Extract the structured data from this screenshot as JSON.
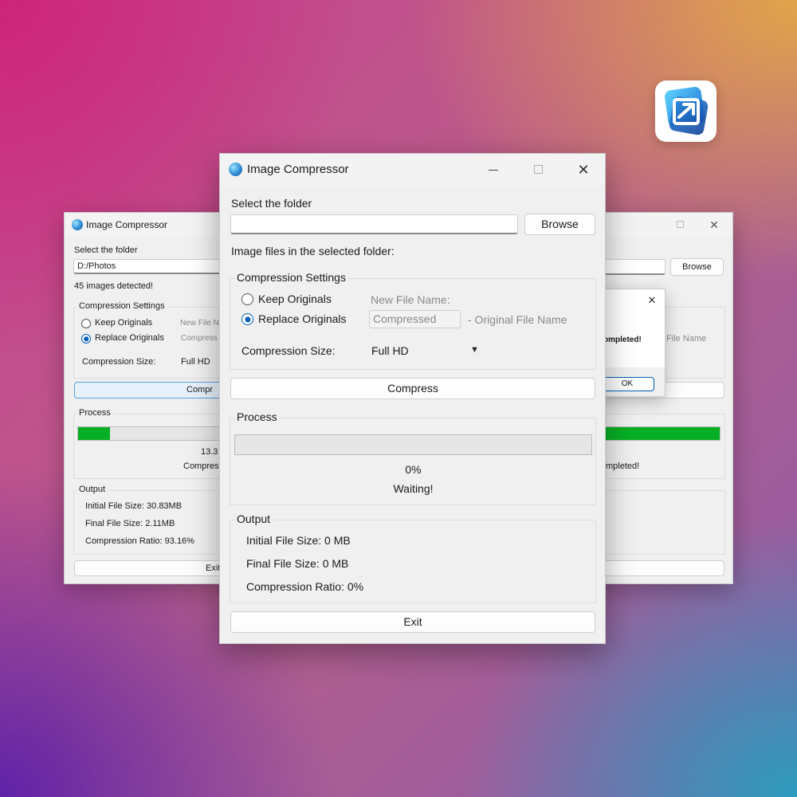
{
  "colors": {
    "accent": "#005fb8",
    "progress_green": "#06b025"
  },
  "left_window": {
    "title": "Image Compressor",
    "folder_label": "Select the folder",
    "folder_value": "D:/Photos",
    "images_detected": "45 images detected!",
    "settings_title": "Compression Settings",
    "keep_originals": "Keep Originals",
    "replace_originals": "Replace Originals",
    "new_file_name_label": "New File N",
    "new_file_name_value": "Compress",
    "size_label": "Compression Size:",
    "size_value": "Full HD",
    "compress_label": "Compr",
    "process_title": "Process",
    "progress_value": 13.3,
    "percent_text": "13.3",
    "status_text": "Compres",
    "output_title": "Output",
    "initial_size": "Initial File Size: 30.83MB",
    "final_size": "Final File Size: 2.11MB",
    "ratio": "Compression Ratio: 93.16%",
    "exit_label": "Exit"
  },
  "right_window": {
    "browse_label": "Browse",
    "file_name_hint": "File Name",
    "progress_value": 100,
    "status_text": "mpleted!",
    "dialog": {
      "message": "ompleted!",
      "ok_label": "OK"
    }
  },
  "main_window": {
    "title": "Image Compressor",
    "folder_label": "Select the folder",
    "folder_value": "",
    "browse_label": "Browse",
    "images_label": "Image files in the selected folder:",
    "settings_title": "Compression Settings",
    "keep_originals": "Keep Originals",
    "replace_originals": "Replace Originals",
    "selected_option": "replace",
    "new_file_name_label": "New File Name:",
    "new_file_name_value": "Compressed",
    "original_file_name_suffix": "- Original File Name",
    "size_label": "Compression Size:",
    "size_value": "Full HD",
    "compress_label": "Compress",
    "process_title": "Process",
    "progress_value": 0,
    "percent_text": "0%",
    "status_text": "Waiting!",
    "output_title": "Output",
    "initial_size": "Initial File Size: 0 MB",
    "final_size": "Final File Size: 0 MB",
    "ratio": "Compression Ratio: 0%",
    "exit_label": "Exit"
  },
  "icons": {
    "app": "image-compressor-app-icon",
    "minimize": "minimize-icon",
    "maximize": "maximize-icon",
    "close": "close-icon",
    "dropdown": "chevron-down-icon"
  }
}
